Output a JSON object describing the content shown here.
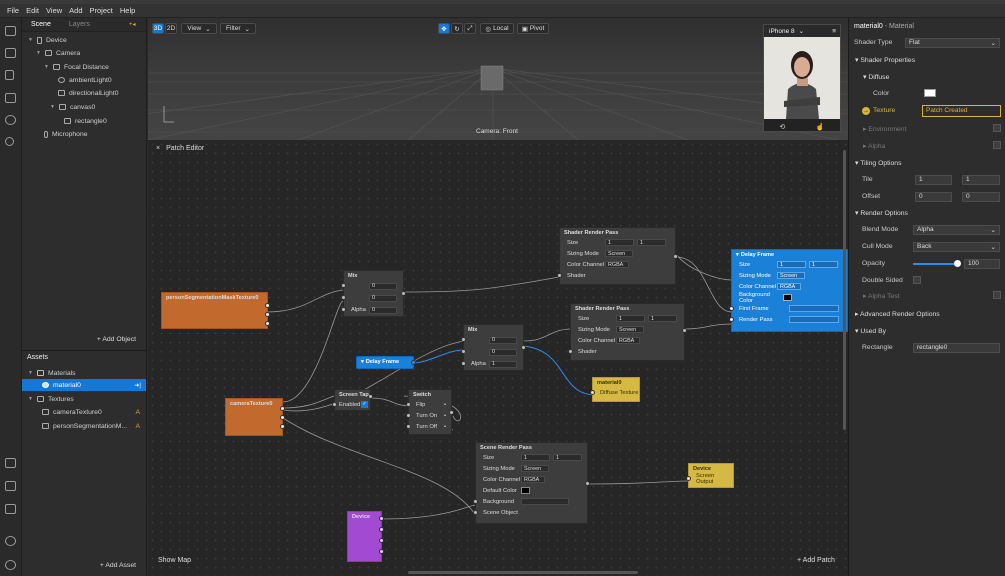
{
  "menu": [
    "File",
    "Edit",
    "View",
    "Add",
    "Project",
    "Help"
  ],
  "scene": {
    "tabs": [
      "Scene",
      "Layers"
    ],
    "items": [
      "Device",
      "Camera",
      "Focal Distance",
      "ambientLight0",
      "directionalLight0",
      "canvas0",
      "rectangle0",
      "Microphone"
    ],
    "add_label": "+ Add Object"
  },
  "assets": {
    "title": "Assets",
    "items": [
      "Materials",
      "material0",
      "Textures",
      "cameraTexture0",
      "personSegmentationM..."
    ],
    "badge": "A",
    "add_label": "+ Add Asset"
  },
  "viewport": {
    "mode3d": "3D",
    "mode2d": "2D",
    "view": "View",
    "filter": "Filter",
    "local": "Local",
    "pivot": "Pivot",
    "camera_label": "Camera: Front",
    "device": "iPhone 8"
  },
  "patch": {
    "title": "Patch Editor",
    "show_map": "Show Map",
    "add_patch": "+ Add Patch",
    "nodes": {
      "seg": "personSegmentationMaskTexture0",
      "cam": "cameraTexture0",
      "mix": "Mix",
      "alpha": "Alpha",
      "delay": "Delay Frame",
      "screentap": "Screen Tap",
      "enabled": "Enabled",
      "switch": "Switch",
      "flip": "Flip",
      "turnon": "Turn On",
      "turnoff": "Turn Off",
      "srp": "Shader Render Pass",
      "size": "Size",
      "sizing": "Sizing Mode",
      "screen": "Screen",
      "channel": "Color Channel",
      "rgba": "RGBA",
      "shader": "Shader",
      "one": "1",
      "zero": "0",
      "material": "material0",
      "diffuse": "Diffuse Texture",
      "scenerp": "Scene Render Pass",
      "defcolor": "Default Color",
      "background": "Background",
      "sceneobj": "Scene Object",
      "device": "Device",
      "screenout": "Screen Output",
      "delayframe": "Delay Frame",
      "bgcolor": "Background Color",
      "firstframe": "First Frame",
      "renderpass": "Render Pass"
    }
  },
  "inspector": {
    "name": "material0",
    "kind": "- Material",
    "shader_type_label": "Shader Type",
    "shader_type": "Flat",
    "shader_props": "Shader Properties",
    "diffuse": "Diffuse",
    "color": "Color",
    "texture": "Texture",
    "texture_value": "Patch Created",
    "environment": "Environment",
    "alpha": "Alpha",
    "tiling": "Tiling Options",
    "tile": "Tile",
    "tile_x": "1",
    "tile_y": "1",
    "offset": "Offset",
    "offset_x": "0",
    "offset_y": "0",
    "render_options": "Render Options",
    "blend_mode_label": "Blend Mode",
    "blend_mode": "Alpha",
    "cull_mode_label": "Cull Mode",
    "cull_mode": "Back",
    "opacity_label": "Opacity",
    "opacity": "100",
    "opacity_level": 0.95,
    "double_sided": "Double Sided",
    "alpha_test": "Alpha Test",
    "advanced": "Advanced Render Options",
    "used_by": "Used By",
    "rectangle": "Rectangle",
    "rectangle_value": "rectangle0"
  }
}
